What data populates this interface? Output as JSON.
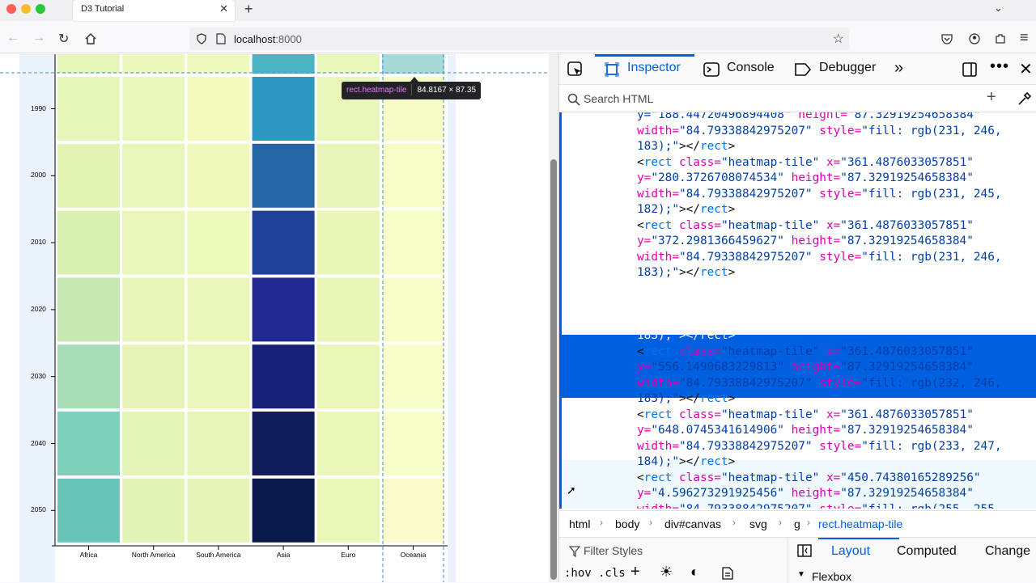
{
  "browser": {
    "tab_title": "D3 Tutorial",
    "url_host": "localhost",
    "url_port": ":8000",
    "traffic_colors": [
      "#ff5f57",
      "#febc2e",
      "#28c840"
    ]
  },
  "devtools": {
    "tabs": [
      "Inspector",
      "Console",
      "Debugger"
    ],
    "search_placeholder": "Search HTML",
    "markup_lines": [
      [
        {
          "t": "av",
          "v": "y=\"188.44720496894408\" "
        },
        {
          "t": "an",
          "v": "height="
        },
        {
          "t": "av",
          "v": "\"87.32919254658384\""
        }
      ],
      [
        {
          "t": "an",
          "v": "width="
        },
        {
          "t": "av",
          "v": "\"84.79338842975207\" "
        },
        {
          "t": "an",
          "v": "style="
        },
        {
          "t": "av",
          "v": "\"fill: rgb(231, 246,"
        }
      ],
      [
        {
          "t": "av",
          "v": "183);\""
        },
        {
          "t": "tx",
          "v": "></"
        },
        {
          "t": "tg",
          "v": "rect"
        },
        {
          "t": "tx",
          "v": ">"
        }
      ],
      [
        {
          "t": "tx",
          "v": "<"
        },
        {
          "t": "tg",
          "v": "rect "
        },
        {
          "t": "an",
          "v": "class="
        },
        {
          "t": "av",
          "v": "\"heatmap-tile\" "
        },
        {
          "t": "an",
          "v": "x="
        },
        {
          "t": "av",
          "v": "\"361.4876033057851\""
        }
      ],
      [
        {
          "t": "an",
          "v": "y="
        },
        {
          "t": "av",
          "v": "\"280.3726708074534\" "
        },
        {
          "t": "an",
          "v": "height="
        },
        {
          "t": "av",
          "v": "\"87.32919254658384\""
        }
      ],
      [
        {
          "t": "an",
          "v": "width="
        },
        {
          "t": "av",
          "v": "\"84.79338842975207\" "
        },
        {
          "t": "an",
          "v": "style="
        },
        {
          "t": "av",
          "v": "\"fill: rgb(231, 245,"
        }
      ],
      [
        {
          "t": "av",
          "v": "182);\""
        },
        {
          "t": "tx",
          "v": "></"
        },
        {
          "t": "tg",
          "v": "rect"
        },
        {
          "t": "tx",
          "v": ">"
        }
      ],
      [
        {
          "t": "tx",
          "v": "<"
        },
        {
          "t": "tg",
          "v": "rect "
        },
        {
          "t": "an",
          "v": "class="
        },
        {
          "t": "av",
          "v": "\"heatmap-tile\" "
        },
        {
          "t": "an",
          "v": "x="
        },
        {
          "t": "av",
          "v": "\"361.4876033057851\""
        }
      ],
      [
        {
          "t": "an",
          "v": "y="
        },
        {
          "t": "av",
          "v": "\"372.2981366459627\" "
        },
        {
          "t": "an",
          "v": "height="
        },
        {
          "t": "av",
          "v": "\"87.32919254658384\""
        }
      ],
      [
        {
          "t": "an",
          "v": "width="
        },
        {
          "t": "av",
          "v": "\"84.79338842975207\" "
        },
        {
          "t": "an",
          "v": "style="
        },
        {
          "t": "av",
          "v": "\"fill: rgb(231, 246,"
        }
      ],
      [
        {
          "t": "av",
          "v": "183);\""
        },
        {
          "t": "tx",
          "v": "></"
        },
        {
          "t": "tg",
          "v": "rect"
        },
        {
          "t": "tx",
          "v": ">"
        }
      ],
      [
        {
          "t": "tx",
          "v": "<"
        },
        {
          "t": "tg",
          "v": "rect "
        },
        {
          "t": "an",
          "v": "class="
        },
        {
          "t": "av",
          "v": "\"heatmap-tile\" "
        },
        {
          "t": "an",
          "v": "x="
        },
        {
          "t": "av",
          "v": "\"361.4876033057851\""
        }
      ],
      [
        {
          "t": "an",
          "v": "y="
        },
        {
          "t": "av",
          "v": "\"464.223602484472\" "
        },
        {
          "t": "an",
          "v": "height="
        },
        {
          "t": "av",
          "v": "\"87.32919254658384\""
        }
      ],
      [
        {
          "t": "an",
          "v": "width="
        },
        {
          "t": "av",
          "v": "\"84.79338842975207\" "
        },
        {
          "t": "an",
          "v": "style="
        },
        {
          "t": "av",
          "v": "\"fill: rgb(231, 246,"
        }
      ],
      [
        {
          "t": "av",
          "v": "183);\""
        },
        {
          "t": "tx",
          "v": "></"
        },
        {
          "t": "tg",
          "v": "rect"
        },
        {
          "t": "tx",
          "v": ">"
        }
      ],
      [
        {
          "t": "tx",
          "v": "<"
        },
        {
          "t": "tg",
          "v": "rect "
        },
        {
          "t": "an",
          "v": "class="
        },
        {
          "t": "av",
          "v": "\"heatmap-tile\" "
        },
        {
          "t": "an",
          "v": "x="
        },
        {
          "t": "av",
          "v": "\"361.4876033057851\""
        }
      ],
      [
        {
          "t": "an",
          "v": "y="
        },
        {
          "t": "av",
          "v": "\"556.1490683229813\" "
        },
        {
          "t": "an",
          "v": "height="
        },
        {
          "t": "av",
          "v": "\"87.32919254658384\""
        }
      ],
      [
        {
          "t": "an",
          "v": "width="
        },
        {
          "t": "av",
          "v": "\"84.79338842975207\" "
        },
        {
          "t": "an",
          "v": "style="
        },
        {
          "t": "av",
          "v": "\"fill: rgb(232, 246,"
        }
      ],
      [
        {
          "t": "av",
          "v": "183);\""
        },
        {
          "t": "tx",
          "v": "></"
        },
        {
          "t": "tg",
          "v": "rect"
        },
        {
          "t": "tx",
          "v": ">"
        }
      ],
      [
        {
          "t": "tx",
          "v": "<"
        },
        {
          "t": "tg",
          "v": "rect "
        },
        {
          "t": "an",
          "v": "class="
        },
        {
          "t": "av",
          "v": "\"heatmap-tile\" "
        },
        {
          "t": "an",
          "v": "x="
        },
        {
          "t": "av",
          "v": "\"361.4876033057851\""
        }
      ],
      [
        {
          "t": "an",
          "v": "y="
        },
        {
          "t": "av",
          "v": "\"648.0745341614906\" "
        },
        {
          "t": "an",
          "v": "height="
        },
        {
          "t": "av",
          "v": "\"87.32919254658384\""
        }
      ],
      [
        {
          "t": "an",
          "v": "width="
        },
        {
          "t": "av",
          "v": "\"84.79338842975207\" "
        },
        {
          "t": "an",
          "v": "style="
        },
        {
          "t": "av",
          "v": "\"fill: rgb(233, 247,"
        }
      ],
      [
        {
          "t": "av",
          "v": "184);\""
        },
        {
          "t": "tx",
          "v": "></"
        },
        {
          "t": "tg",
          "v": "rect"
        },
        {
          "t": "tx",
          "v": ">"
        }
      ],
      [
        {
          "t": "tx",
          "v": "<"
        },
        {
          "t": "tg",
          "v": "rect "
        },
        {
          "t": "an",
          "v": "class="
        },
        {
          "t": "av",
          "v": "\"heatmap-tile\" "
        },
        {
          "t": "an",
          "v": "x="
        },
        {
          "t": "av",
          "v": "\"450.74380165289256\""
        }
      ],
      [
        {
          "t": "an",
          "v": "y="
        },
        {
          "t": "av",
          "v": "\"4.596273291925456\" "
        },
        {
          "t": "an",
          "v": "height="
        },
        {
          "t": "av",
          "v": "\"87.32919254658384\""
        }
      ],
      [
        {
          "t": "an",
          "v": "width="
        },
        {
          "t": "av",
          "v": "\"84.79338842975207\" "
        },
        {
          "t": "an",
          "v": "style="
        },
        {
          "t": "av",
          "v": "\"fill: rgb(255, 255,"
        }
      ]
    ],
    "selected_line_indices": [
      11,
      12,
      13,
      14
    ],
    "breadcrumbs": [
      "html",
      "body",
      "div#canvas",
      "svg",
      "g",
      "rect.heatmap-tile"
    ],
    "filter_styles_placeholder": "Filter Styles",
    "hov_label": ":hov",
    "cls_label": ".cls",
    "right_tabs": [
      "Layout",
      "Computed",
      "Change"
    ],
    "flexbox_label": "Flexbox"
  },
  "tooltip": {
    "element": "rect.heatmap-tile",
    "size": "84.8167 × 87.35"
  },
  "chart_data": {
    "type": "heatmap",
    "categories": [
      "Africa",
      "North America",
      "South America",
      "Asia",
      "Euro",
      "Oceania"
    ],
    "y_ticks": [
      "1990",
      "2000",
      "2010",
      "2020",
      "2030",
      "2040",
      "2050"
    ],
    "series": [
      {
        "name": "Africa",
        "colors": [
          "#e6f5b8",
          "#e3f4b4",
          "#d9f0b3",
          "#c6e9b4",
          "#a6dcb6",
          "#7ccfb8",
          "#67c5ba"
        ]
      },
      {
        "name": "North America",
        "colors": [
          "#eaf7ba",
          "#e8f6b9",
          "#e8f6b9",
          "#e7f6b8",
          "#e6f5b7",
          "#e5f5b7",
          "#e4f4b6"
        ]
      },
      {
        "name": "South America",
        "colors": [
          "#f2fabd",
          "#eff9bc",
          "#edf8bb",
          "#ebf7ba",
          "#e9f6b9",
          "#e7f5b8",
          "#e6f5b7"
        ]
      },
      {
        "name": "Asia",
        "colors": [
          "#2c97bf",
          "#2566a5",
          "#22419a",
          "#20298f",
          "#172078",
          "#101c5b",
          "#0a1a4d"
        ]
      },
      {
        "name": "Euro",
        "colors": [
          "#e8f6b9",
          "#e7f5b8",
          "#e7f6b7",
          "#e7f6b7",
          "#e8f6b7",
          "#e9f7b8",
          "#e9f7b8"
        ]
      },
      {
        "name": "Oceania",
        "colors": [
          "#f7fcc7",
          "#f8fcc8",
          "#f8fcc8",
          "#f8fdc9",
          "#f9fdca",
          "#f9fdca",
          "#fafdcb"
        ]
      }
    ],
    "top_row_colors": [
      "#e6f5b8",
      "#ebf7bb",
      "#eff9bd",
      "#4bb3c2",
      "#e9f6b9",
      "#a8d9d9"
    ]
  }
}
